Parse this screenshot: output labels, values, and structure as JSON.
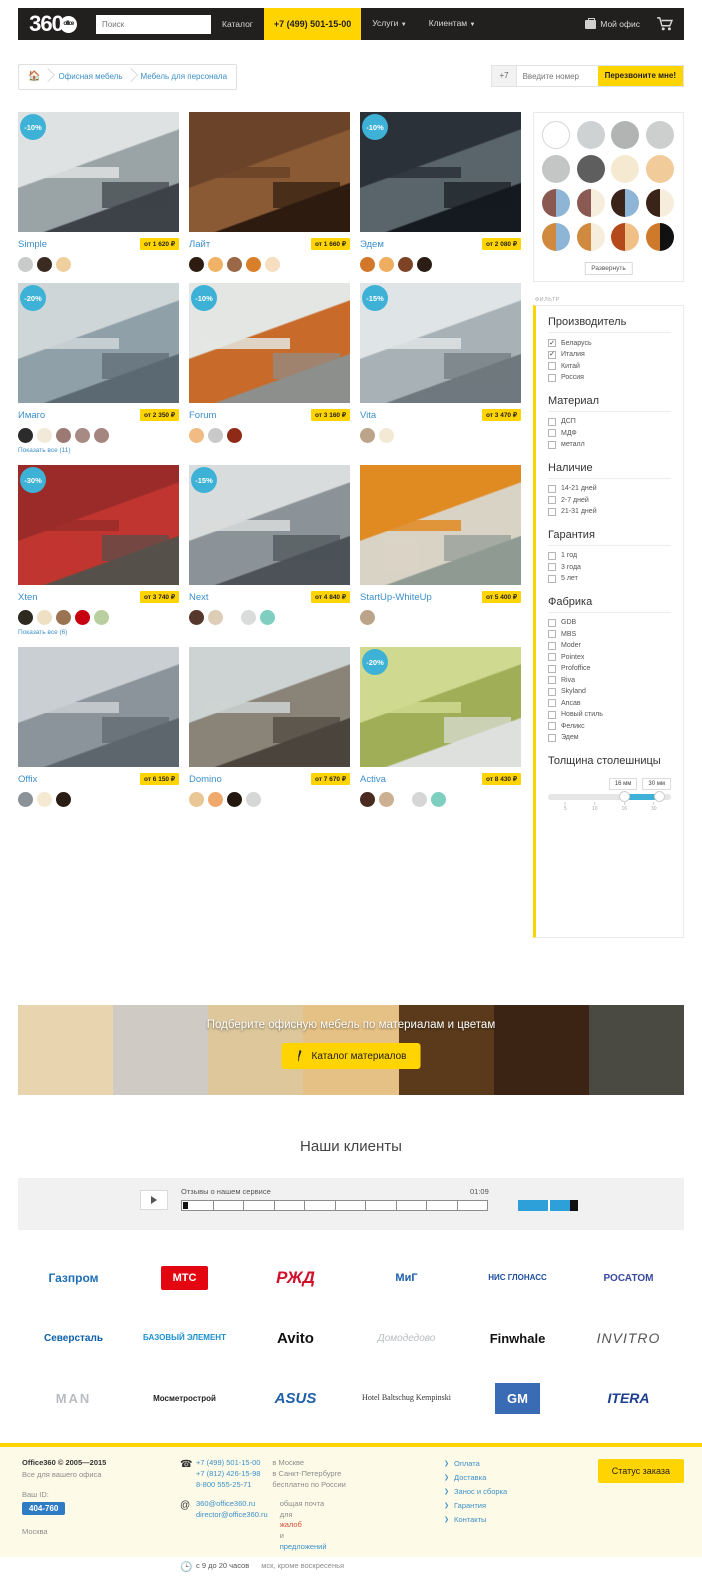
{
  "header": {
    "logo_text": "360",
    "logo_badge": "office",
    "search_placeholder": "Поиск",
    "nav": [
      {
        "label": "Каталог",
        "type": "link"
      },
      {
        "label": "+7 (499) 501-15-00",
        "type": "phone"
      },
      {
        "label": "Услуги",
        "type": "dropdown"
      },
      {
        "label": "Клиентам",
        "type": "dropdown"
      }
    ],
    "my_office": "Мой офис",
    "accent_color": "#ffd400",
    "bar_color": "#221f1f"
  },
  "breadcrumb": {
    "home_icon": "home-icon",
    "items": [
      "Офисная мебель",
      "Мебель для персонала"
    ]
  },
  "callback": {
    "prefix": "+7",
    "placeholder": "Введите номер",
    "button": "Перезвоните мне!"
  },
  "products": [
    [
      {
        "name": "Simple",
        "price": "от 1 620 ₽",
        "badge": "-10%",
        "swatches": [
          "#c8cbca",
          "#3a2b22",
          "#f0cf9e"
        ],
        "show_all": null
      },
      {
        "name": "Лайт",
        "price": "от 1 660 ₽",
        "badge": null,
        "swatches": [
          "#2c1c12",
          "#f0b264",
          "#9a6847",
          "#d97f2a",
          "#f6dec0"
        ],
        "show_all": null
      },
      {
        "name": "Эдем",
        "price": "от 2 080 ₽",
        "badge": "-10%",
        "swatches": [
          "#d2762a",
          "#eead5f",
          "#7c4326",
          "#2b1d14"
        ],
        "show_all": null
      }
    ],
    [
      {
        "name": "Имаго",
        "price": "от 2 350 ₽",
        "badge": "-20%",
        "swatches": [
          "#2b2b2b",
          "#f2ead8",
          "#9c7a74",
          "#a78a84",
          "#a5867e"
        ],
        "show_all": "Показать все (11)"
      },
      {
        "name": "Forum",
        "price": "от 3 160 ₽",
        "badge": "-10%",
        "swatches": [
          "#f0bc84",
          "#c9c9c9",
          "#8f2a16"
        ],
        "show_all": null
      },
      {
        "name": "Vita",
        "price": "от 3 470 ₽",
        "badge": "-15%",
        "swatches": [
          "#bba489",
          "#f2ead4"
        ],
        "show_all": null
      }
    ],
    [
      {
        "name": "Xten",
        "price": "от 3 740 ₽",
        "badge": "-30%",
        "swatches": [
          "#2e2a20",
          "#efe0c4",
          "#9a7450",
          "#c7000f",
          "#b9cfa0"
        ],
        "show_all": "Показать все (6)"
      },
      {
        "name": "Next",
        "price": "от 4 840 ₽",
        "badge": "-15%",
        "swatches": [
          "#56372c",
          "#ddcdb6",
          "#d9dcdb",
          "#7fcfc0"
        ],
        "show_all": null
      },
      {
        "name": "StartUp-WhiteUp",
        "price": "от 5 400 ₽",
        "badge": null,
        "swatches": [
          "#bba489"
        ],
        "show_all": null
      }
    ],
    [
      {
        "name": "Offix",
        "price": "от 6 150 ₽",
        "badge": null,
        "swatches": [
          "#8c9398",
          "#f4ead2",
          "#2b1d14"
        ],
        "show_all": null
      },
      {
        "name": "Domino",
        "price": "от 7 670 ₽",
        "badge": null,
        "swatches": [
          "#e8c795",
          "#f0a96c",
          "#24170f",
          "#d6d6d6"
        ],
        "show_all": null
      },
      {
        "name": "Activa",
        "price": "от 8 430 ₽",
        "badge": "-20%",
        "swatches": [
          "#4a2b22",
          "#cbb191",
          "#d6d6d6",
          "#7fcfc0"
        ],
        "show_all": null
      }
    ]
  ],
  "color_panel": {
    "expand_label": "Развернуть",
    "dots": [
      {
        "type": "solid",
        "a": "#ffffff",
        "outline": true
      },
      {
        "type": "solid",
        "a": "#cfd2d2"
      },
      {
        "type": "solid",
        "a": "#b2b4b4"
      },
      {
        "type": "solid",
        "a": "#cdcfcf"
      },
      {
        "type": "solid",
        "a": "#c4c6c6"
      },
      {
        "type": "solid",
        "a": "#5e5e5e"
      },
      {
        "type": "solid",
        "a": "#f6e9d2"
      },
      {
        "type": "solid",
        "a": "#f2cb9b"
      },
      {
        "type": "split",
        "a": "#8a5a52",
        "b": "#8fb5d6"
      },
      {
        "type": "split",
        "a": "#8a5a52",
        "b": "#f6eddc"
      },
      {
        "type": "split",
        "a": "#3a2319",
        "b": "#8fb5d6"
      },
      {
        "type": "split",
        "a": "#3a2319",
        "b": "#f6eddc"
      },
      {
        "type": "split",
        "a": "#cf8a3f",
        "b": "#8fb5d6"
      },
      {
        "type": "split",
        "a": "#cf8a3f",
        "b": "#f6eddc"
      },
      {
        "type": "split",
        "a": "#b4491c",
        "b": "#f0c087"
      },
      {
        "type": "split",
        "a": "#cf7a2a",
        "b": "#111111"
      }
    ]
  },
  "filter": {
    "label": "ФИЛЬТР",
    "groups": [
      {
        "title": "Производитель",
        "options": [
          {
            "label": "Беларусь",
            "checked": true
          },
          {
            "label": "Италия",
            "checked": true
          },
          {
            "label": "Китай",
            "checked": false
          },
          {
            "label": "Россия",
            "checked": false
          }
        ]
      },
      {
        "title": "Материал",
        "options": [
          {
            "label": "ДСП",
            "checked": false
          },
          {
            "label": "МДФ",
            "checked": false
          },
          {
            "label": "металл",
            "checked": false
          }
        ]
      },
      {
        "title": "Наличие",
        "options": [
          {
            "label": "14-21 дней",
            "checked": false
          },
          {
            "label": "2-7 дней",
            "checked": false
          },
          {
            "label": "21-31 дней",
            "checked": false
          }
        ]
      },
      {
        "title": "Гарантия",
        "options": [
          {
            "label": "1 год",
            "checked": false
          },
          {
            "label": "3 года",
            "checked": false
          },
          {
            "label": "5 лет",
            "checked": false
          }
        ]
      },
      {
        "title": "Фабрика",
        "options": [
          {
            "label": "GDB",
            "checked": false
          },
          {
            "label": "MBS",
            "checked": false
          },
          {
            "label": "Moder",
            "checked": false
          },
          {
            "label": "Pointex",
            "checked": false
          },
          {
            "label": "Profoffice",
            "checked": false
          },
          {
            "label": "Riva",
            "checked": false
          },
          {
            "label": "Skyland",
            "checked": false
          },
          {
            "label": "Апсав",
            "checked": false
          },
          {
            "label": "Новый стиль",
            "checked": false
          },
          {
            "label": "Феликс",
            "checked": false
          },
          {
            "label": "Эдем",
            "checked": false
          }
        ]
      }
    ],
    "thickness": {
      "title": "Толщина столешницы",
      "min_pill": "16 мм",
      "max_pill": "30 мм",
      "ticks": [
        "5",
        "10",
        "16",
        "30"
      ]
    }
  },
  "banner": {
    "text": "Подберите офисную мебель по материалам и цветам",
    "button": "Каталог материалов",
    "icon": "brush-icon",
    "stripes": [
      "#e8d5b0",
      "#cfcac4",
      "#ddc79b",
      "#e6c185",
      "#5a3a1b",
      "#3b2414",
      "#4b4a42"
    ]
  },
  "clients": {
    "title": "Наши клиенты",
    "video": {
      "title": "Отзывы о нашем сервисе",
      "duration": "01:09",
      "play_icon": "play-icon"
    },
    "logos": [
      [
        "Газпром",
        "МТС",
        "РЖД",
        "МиГ",
        "НИС ГЛОНАСС",
        "РОСАТОМ"
      ],
      [
        "Северсталь",
        "БАЗОВЫЙ ЭЛЕМЕНТ",
        "Avito",
        "Домодедово",
        "Finwhale",
        "INVITRO"
      ],
      [
        "MAN",
        "Мосметрострой",
        "ASUS",
        "Hotel Baltschug Kempinski",
        "GM",
        "ITERA"
      ]
    ]
  },
  "footer": {
    "brand": "Office360 © 2005—2015",
    "tagline": "Все для вашего офиса",
    "id_label": "Ваш ID:",
    "id_value": "404-760",
    "city": "Москва",
    "phones": [
      "+7 (499) 501-15-00",
      "+7 (812) 426-15-98",
      "8-800 555-25-71"
    ],
    "phone_notes": [
      "в Москве",
      "в Санкт-Петербурге",
      "бесплатно по России"
    ],
    "emails": [
      "360@office360.ru",
      "director@office360.ru"
    ],
    "email_note_1": "общая почта",
    "email_note_2_pre": "для ",
    "email_note_2_red": "жалоб",
    "email_note_2_mid": " и ",
    "email_note_2_blue": "предложений",
    "hours": "с 9 до 20 часов",
    "hours_note": "мск, кроме воскресенья",
    "links": [
      "Оплата",
      "Доставка",
      "Занос и сборка",
      "Гарантия",
      "Контакты"
    ],
    "status_button": "Статус заказа"
  }
}
